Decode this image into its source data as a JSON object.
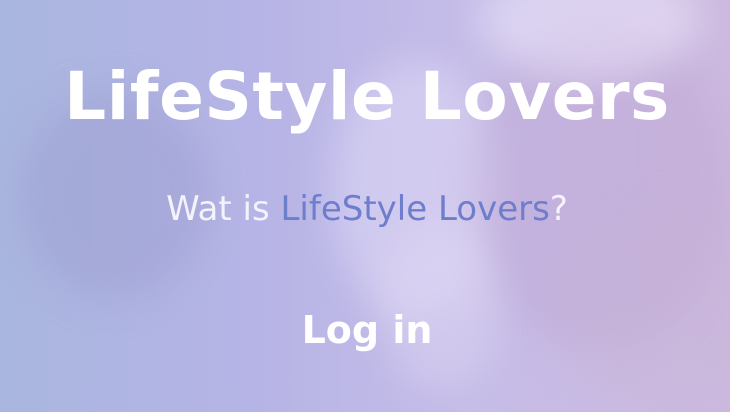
{
  "hero": {
    "title": "LifeStyle Lovers",
    "question_prefix": "Wat is ",
    "question_link": "LifeStyle Lovers",
    "question_suffix": "?",
    "login_label": "Log in"
  },
  "colors": {
    "title": "#ffffff",
    "link": "#6e7dcc",
    "text": "#f4f2fb",
    "background_start": "#a9b6df",
    "background_end": "#cdb9df"
  }
}
